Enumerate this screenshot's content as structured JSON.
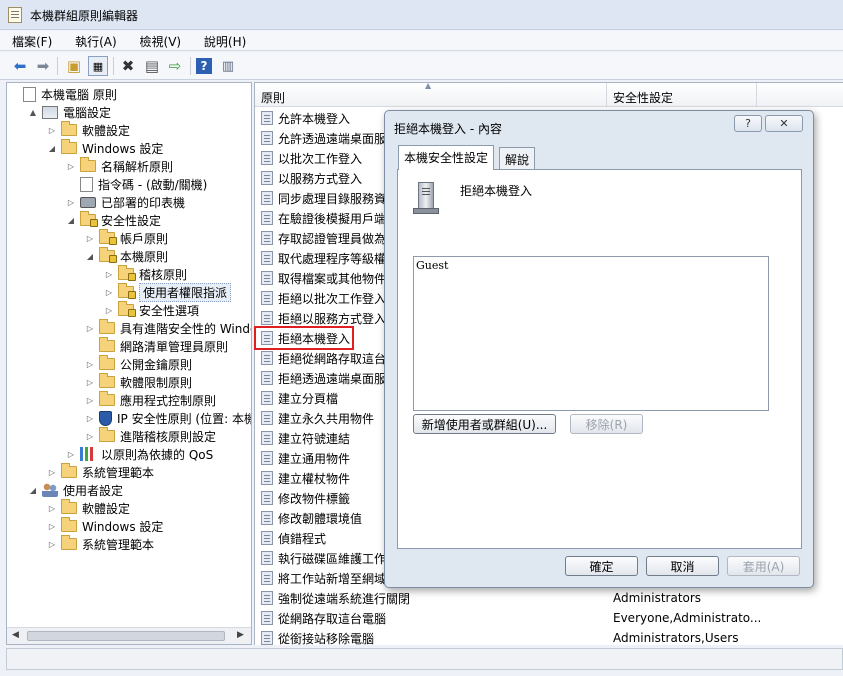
{
  "window": {
    "title": "本機群組原則編輯器"
  },
  "menu": [
    "檔案(F)",
    "執行(A)",
    "檢視(V)",
    "說明(H)"
  ],
  "toolbar": {
    "icons": [
      "back-arrow-icon",
      "forward-arrow-icon",
      "up-folder-icon",
      "show-hide-tree-icon",
      "delete-icon",
      "properties-icon",
      "export-icon",
      "help-icon",
      "extended-view-icon"
    ]
  },
  "tree": [
    {
      "label": "本機電腦 原則",
      "icon": "computer-policy-icon",
      "indent": 0,
      "exp": ""
    },
    {
      "label": "電腦設定",
      "icon": "computer-icon",
      "indent": 1,
      "exp": "▲"
    },
    {
      "label": "軟體設定",
      "icon": "folder-icon",
      "indent": 2,
      "exp": "▷"
    },
    {
      "label": "Windows 設定",
      "icon": "folder-icon",
      "indent": 2,
      "exp": "◢"
    },
    {
      "label": "名稱解析原則",
      "icon": "folder-icon",
      "indent": 3,
      "exp": "▷"
    },
    {
      "label": "指令碼 - (啟動/關機)",
      "icon": "script-icon",
      "indent": 3,
      "exp": ""
    },
    {
      "label": "已部署的印表機",
      "icon": "printer-icon",
      "indent": 3,
      "exp": "▷"
    },
    {
      "label": "安全性設定",
      "icon": "security-settings-icon",
      "indent": 3,
      "exp": "◢"
    },
    {
      "label": "帳戶原則",
      "icon": "security-folder-icon",
      "indent": 4,
      "exp": "▷"
    },
    {
      "label": "本機原則",
      "icon": "security-folder-icon",
      "indent": 4,
      "exp": "◢"
    },
    {
      "label": "稽核原則",
      "icon": "security-folder-icon",
      "indent": 5,
      "exp": "▷"
    },
    {
      "label": "使用者權限指派",
      "icon": "security-folder-icon",
      "indent": 5,
      "exp": "▷",
      "selected": true
    },
    {
      "label": "安全性選項",
      "icon": "security-folder-icon",
      "indent": 5,
      "exp": "▷"
    },
    {
      "label": "具有進階安全性的 Windows",
      "icon": "folder-icon",
      "indent": 4,
      "exp": "▷"
    },
    {
      "label": "網路清單管理員原則",
      "icon": "folder-icon",
      "indent": 4,
      "exp": ""
    },
    {
      "label": "公開金鑰原則",
      "icon": "folder-icon",
      "indent": 4,
      "exp": "▷"
    },
    {
      "label": "軟體限制原則",
      "icon": "folder-icon",
      "indent": 4,
      "exp": "▷"
    },
    {
      "label": "應用程式控制原則",
      "icon": "folder-icon",
      "indent": 4,
      "exp": "▷"
    },
    {
      "label": "IP 安全性原則 (位置: 本機電",
      "icon": "shield-icon",
      "indent": 4,
      "exp": "▷"
    },
    {
      "label": "進階稽核原則設定",
      "icon": "folder-icon",
      "indent": 4,
      "exp": "▷"
    },
    {
      "label": "以原則為依據的 QoS",
      "icon": "qos-chart-icon",
      "indent": 3,
      "exp": "▷"
    },
    {
      "label": "系統管理範本",
      "icon": "folder-icon",
      "indent": 2,
      "exp": "▷"
    },
    {
      "label": "使用者設定",
      "icon": "users-icon",
      "indent": 1,
      "exp": "◢"
    },
    {
      "label": "軟體設定",
      "icon": "folder-icon",
      "indent": 2,
      "exp": "▷"
    },
    {
      "label": "Windows 設定",
      "icon": "folder-icon",
      "indent": 2,
      "exp": "▷"
    },
    {
      "label": "系統管理範本",
      "icon": "folder-icon",
      "indent": 2,
      "exp": "▷"
    }
  ],
  "list": {
    "columns": [
      "原則",
      "安全性設定"
    ],
    "rows": [
      {
        "name": "允許本機登入",
        "setting": ""
      },
      {
        "name": "允許透過遠端桌面服",
        "setting": ""
      },
      {
        "name": "以批次工作登入",
        "setting": ""
      },
      {
        "name": "以服務方式登入",
        "setting": ""
      },
      {
        "name": "同步處理目錄服務資",
        "setting": ""
      },
      {
        "name": "在驗證後模擬用戶端",
        "setting": ""
      },
      {
        "name": "存取認證管理員做為",
        "setting": ""
      },
      {
        "name": "取代處理程序等級權",
        "setting": ""
      },
      {
        "name": "取得檔案或其他物件",
        "setting": ""
      },
      {
        "name": "拒絕以批次工作登入",
        "setting": ""
      },
      {
        "name": "拒絕以服務方式登入",
        "setting": ""
      },
      {
        "name": "拒絕本機登入",
        "setting": "",
        "highlighted": true
      },
      {
        "name": "拒絕從網路存取這台",
        "setting": ""
      },
      {
        "name": "拒絕透過遠端桌面服",
        "setting": ""
      },
      {
        "name": "建立分頁檔",
        "setting": ""
      },
      {
        "name": "建立永久共用物件",
        "setting": ""
      },
      {
        "name": "建立符號連結",
        "setting": ""
      },
      {
        "name": "建立通用物件",
        "setting": ""
      },
      {
        "name": "建立權杖物件",
        "setting": ""
      },
      {
        "name": "修改物件標籤",
        "setting": ""
      },
      {
        "name": "修改韌體環境值",
        "setting": ""
      },
      {
        "name": "偵錯程式",
        "setting": ""
      },
      {
        "name": "執行磁碟區維護工作",
        "setting": ""
      },
      {
        "name": "將工作站新增至網域",
        "setting": ""
      },
      {
        "name": "強制從遠端系統進行關閉",
        "setting": "Administrators"
      },
      {
        "name": "從網路存取這台電腦",
        "setting": "Everyone,Administrato..."
      },
      {
        "name": "從銜接站移除電腦",
        "setting": "Administrators,Users"
      }
    ]
  },
  "dialog": {
    "title": "拒絕本機登入 - 內容",
    "help_label": "?",
    "close_label": "✕",
    "tabs": [
      "本機安全性設定",
      "解說"
    ],
    "heading": "拒絕本機登入",
    "members": [
      "Guest"
    ],
    "add_button": "新增使用者或群組(U)...",
    "remove_button": "移除(R)",
    "ok_button": "確定",
    "cancel_button": "取消",
    "apply_button": "套用(A)"
  }
}
